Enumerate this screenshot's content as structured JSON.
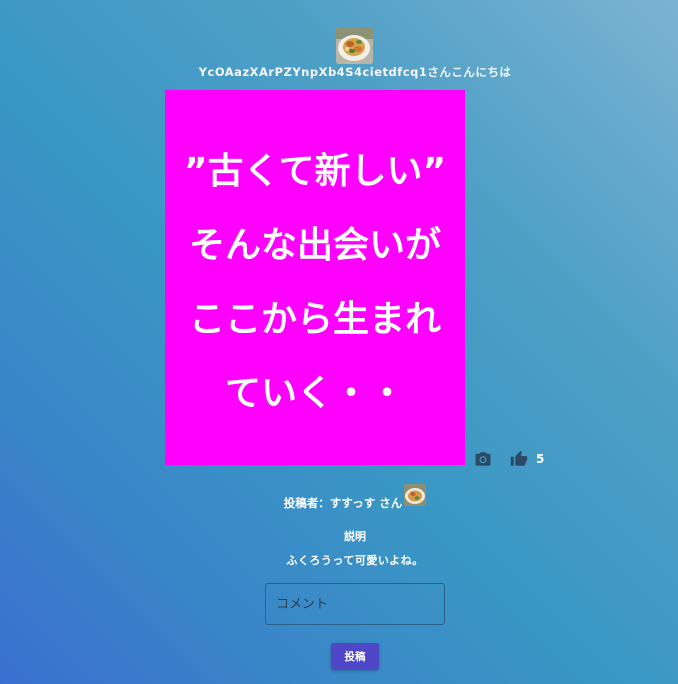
{
  "header": {
    "greeting": "YcOAazXArPZYnpXb4S4cietdfcq1さんこんにちは"
  },
  "post": {
    "image_lines": [
      "”古くて新しい”",
      "そんな出会いが",
      "ここから生まれ",
      "ていく・・"
    ],
    "image_bg_color": "#ff00ff",
    "like_count": "5",
    "poster_label": "投稿者：すすっす さん",
    "description_heading": "説明",
    "description": "ふくろうって可愛いよね。"
  },
  "comment_form": {
    "placeholder": "コメント",
    "submit_label": "投稿"
  },
  "icons": {
    "camera": "camera-icon",
    "like": "thumb-up-icon"
  },
  "colors": {
    "button": "#4f46c8",
    "input_border": "#2c5f86"
  }
}
